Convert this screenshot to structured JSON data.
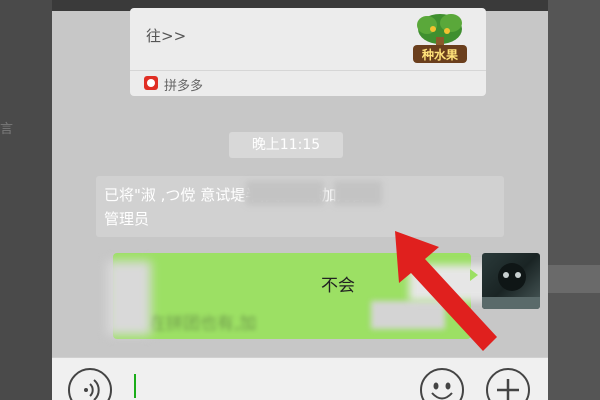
{
  "card": {
    "link_text": "往>>",
    "thumbnail_label": "种水果",
    "source_label": "拼多多",
    "source_icon": "pinduoduo-heart-icon"
  },
  "timestamp": "晚上11:15",
  "system_message": {
    "line1": "已将\"淑 ,つ傥        意试堤半,天、 \"添加为群",
    "line2": "管理员"
  },
  "message": {
    "line1": "不会",
    "line2": "在拼团也有,加"
  },
  "input_bar": {
    "voice_icon": "voice-icon",
    "emoji_icon": "emoji-icon",
    "plus_icon": "plus-icon"
  },
  "annotation": {
    "arrow_color": "#e0201e"
  },
  "colors": {
    "bubble": "#9ce064",
    "brand_red": "#e02e24",
    "caret": "#1aad19"
  }
}
